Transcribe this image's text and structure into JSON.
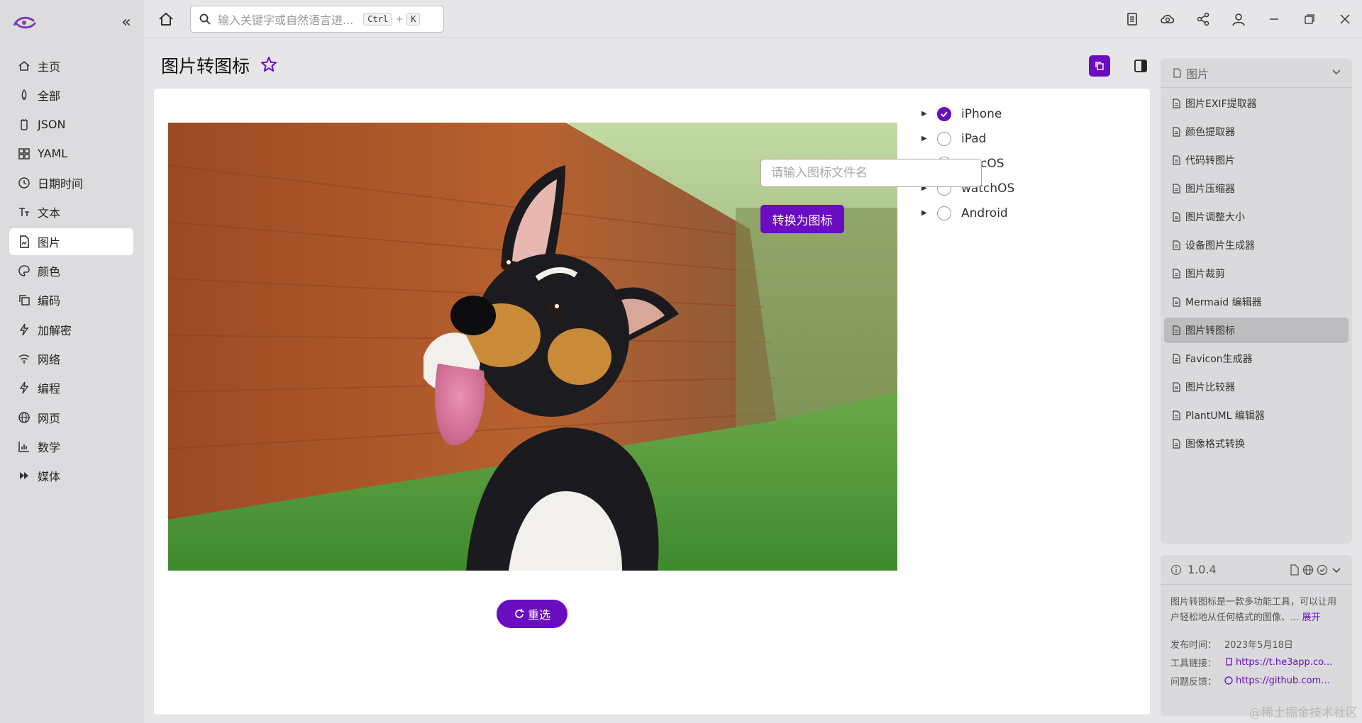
{
  "sidebar": {
    "items": [
      {
        "label": "主页",
        "icon": "home-icon"
      },
      {
        "label": "全部",
        "icon": "rocket-icon"
      },
      {
        "label": "JSON",
        "icon": "braces-icon"
      },
      {
        "label": "YAML",
        "icon": "grid-icon"
      },
      {
        "label": "日期时间",
        "icon": "clock-icon"
      },
      {
        "label": "文本",
        "icon": "text-icon"
      },
      {
        "label": "图片",
        "icon": "image-icon"
      },
      {
        "label": "颜色",
        "icon": "palette-icon"
      },
      {
        "label": "编码",
        "icon": "copy-icon"
      },
      {
        "label": "加解密",
        "icon": "bolt-icon"
      },
      {
        "label": "网络",
        "icon": "wifi-icon"
      },
      {
        "label": "编程",
        "icon": "bolt-icon"
      },
      {
        "label": "网页",
        "icon": "globe-icon"
      },
      {
        "label": "数学",
        "icon": "chart-icon"
      },
      {
        "label": "媒体",
        "icon": "forward-icon"
      }
    ],
    "active_index": 6
  },
  "search": {
    "placeholder": "输入关键字或自然语言进...",
    "shortcut_key1": "Ctrl",
    "shortcut_plus": "+",
    "shortcut_key2": "K"
  },
  "page": {
    "title": "图片转图标"
  },
  "options": [
    {
      "label": "iPhone",
      "checked": true
    },
    {
      "label": "iPad",
      "checked": false
    },
    {
      "label": "macOS",
      "checked": false
    },
    {
      "label": "watchOS",
      "checked": false
    },
    {
      "label": "Android",
      "checked": false
    }
  ],
  "filename_placeholder": "请输入图标文件名",
  "convert_label": "转换为图标",
  "reselect_label": "重选",
  "right_panel": {
    "header": "图片",
    "items": [
      "图片EXIF提取器",
      "颜色提取器",
      "代码转图片",
      "图片压缩器",
      "图片调整大小",
      "设备图片生成器",
      "图片裁剪",
      "Mermaid 编辑器",
      "图片转图标",
      "Favicon生成器",
      "图片比较器",
      "PlantUML 编辑器",
      "图像格式转换"
    ],
    "active_index": 8
  },
  "info": {
    "version": "1.0.4",
    "description": "图片转图标是一款多功能工具，可以让用户轻松地从任何格式的图像、...",
    "more": "展开",
    "release_label": "发布时间：",
    "release_value": "2023年5月18日",
    "link_label": "工具链接：",
    "link_value": "https://t.he3app.co...",
    "feedback_label": "问题反馈：",
    "feedback_value": "https://github.com..."
  },
  "watermark": "@稀土掘金技术社区",
  "colors": {
    "accent": "#6a0dc0",
    "sidebar_bg": "#dcdcdf",
    "panel_bg": "#dadadd"
  }
}
